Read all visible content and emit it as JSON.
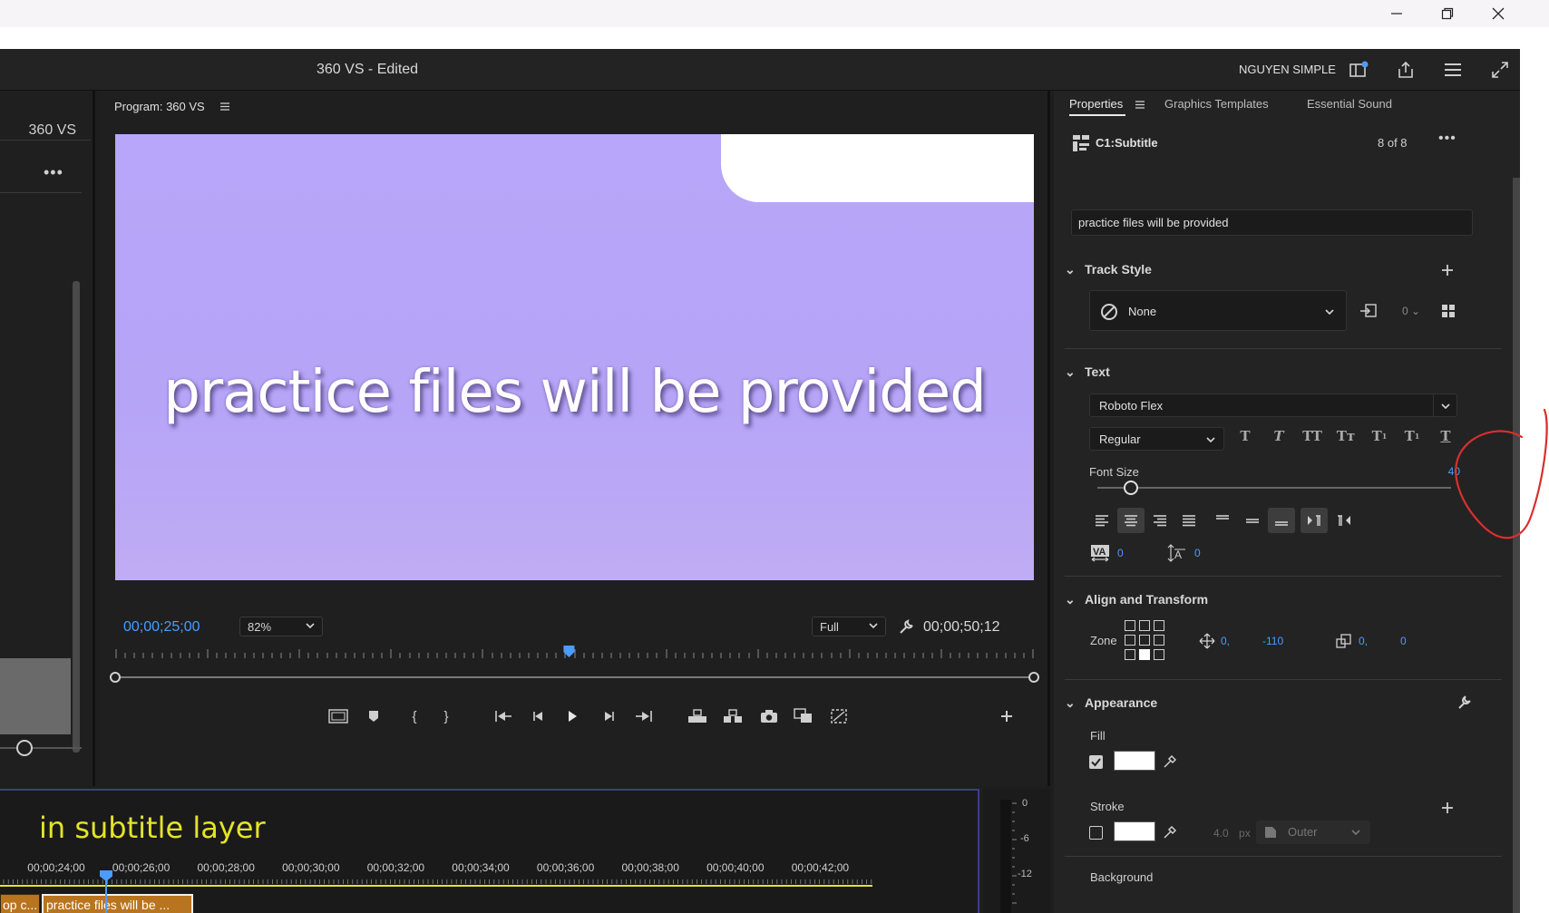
{
  "header": {
    "title": "360 VS",
    "title_suffix": " - Edited",
    "user": "NGUYEN SIMPLE"
  },
  "left_panel": {
    "label": "360 VS"
  },
  "program_monitor": {
    "tab_label": "Program: 360 VS",
    "caption": "practice files will be provided",
    "current_timecode": "00;00;25;00",
    "zoom": "82%",
    "resolution": "Full",
    "duration_timecode": "00;00;50;12",
    "playhead_position": 0.494
  },
  "timeline": {
    "annotation": "in subtitle layer",
    "ruler": [
      "00;00;24;00",
      "00;00;26;00",
      "00;00;28;00",
      "00;00;30;00",
      "00;00;32;00",
      "00;00;34;00",
      "00;00;36;00",
      "00;00;38;00",
      "00;00;40;00",
      "00;00;42;00"
    ],
    "clip_prev": "op c...",
    "clip_current": "practice files will be ...",
    "meter_labels": [
      "0",
      "-6",
      "-12"
    ]
  },
  "properties": {
    "tabs": [
      "Properties",
      "Graphics Templates",
      "Essential Sound"
    ],
    "item_name": "C1:Subtitle",
    "item_count": "8 of 8",
    "caption_text": "practice files will be provided",
    "track_style": {
      "heading": "Track Style",
      "value": "None",
      "count": "0"
    },
    "text": {
      "heading": "Text",
      "font": "Roboto Flex",
      "style": "Regular",
      "font_size_label": "Font Size",
      "font_size": "40",
      "font_size_level": 0.094,
      "kerning": "0",
      "leading": "0"
    },
    "align_transform": {
      "heading": "Align and Transform",
      "zone_label": "Zone",
      "pos_x": "0,",
      "pos_y": "-110",
      "scale_x": "0,",
      "scale_y": "0"
    },
    "appearance": {
      "heading": "Appearance",
      "fill_label": "Fill",
      "stroke_label": "Stroke",
      "stroke_width": "4.0",
      "stroke_unit": "px",
      "stroke_type": "Outer",
      "background_label": "Background"
    }
  },
  "colors": {
    "accent": "#4b9cff",
    "video_bg": "#b7a6f9",
    "annotation": "#e3e32a",
    "clip": "#b8741f",
    "markup": "#d8302f"
  }
}
